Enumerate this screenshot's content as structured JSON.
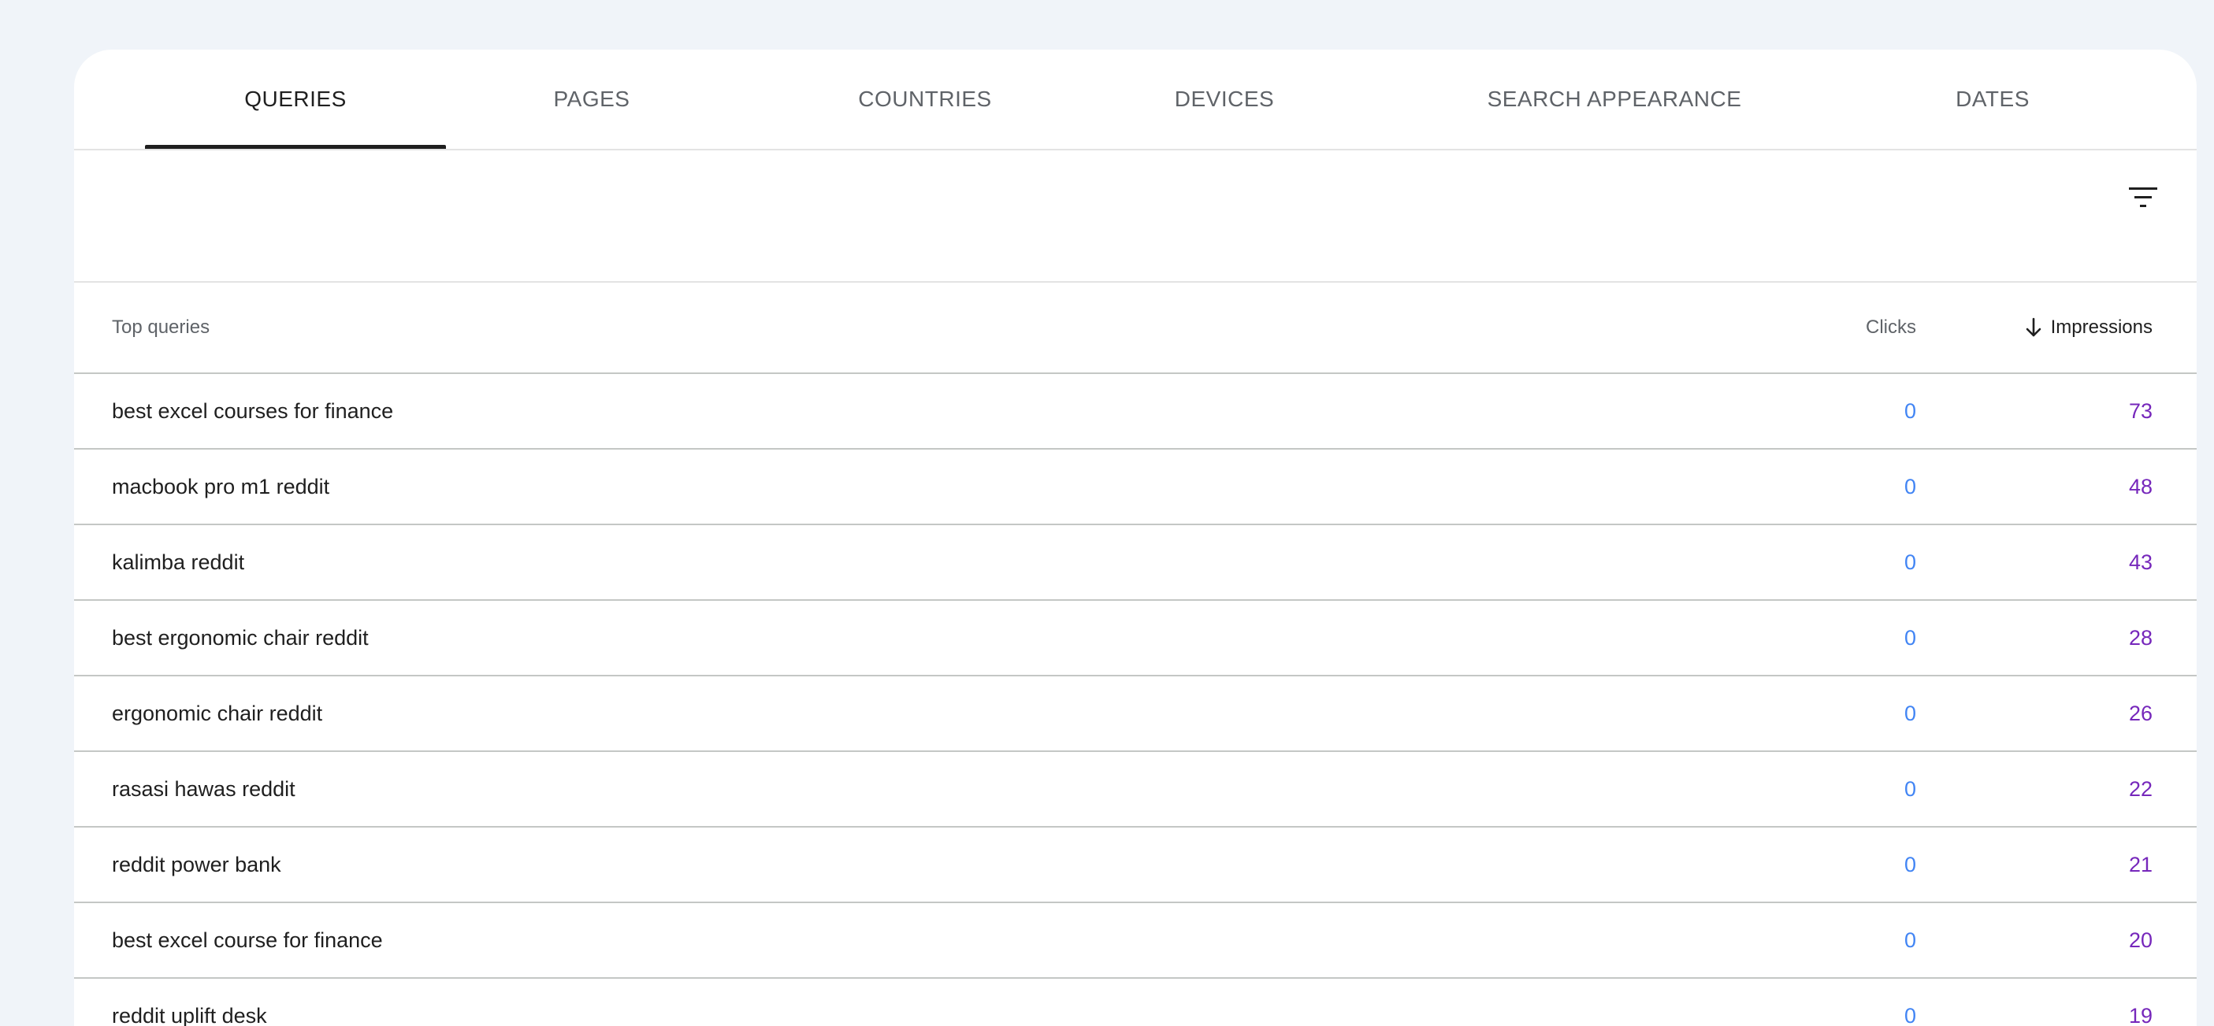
{
  "tabs": [
    {
      "label": "QUERIES",
      "active": true
    },
    {
      "label": "PAGES",
      "active": false
    },
    {
      "label": "COUNTRIES",
      "active": false
    },
    {
      "label": "DEVICES",
      "active": false
    },
    {
      "label": "SEARCH APPEARANCE",
      "active": false
    },
    {
      "label": "DATES",
      "active": false
    }
  ],
  "toolbar": {
    "filter_icon": "filter-list-icon"
  },
  "table": {
    "headers": {
      "query": "Top queries",
      "clicks": "Clicks",
      "impressions": "Impressions",
      "sort_icon": "arrow-down-icon"
    },
    "rows": [
      {
        "query": "best excel courses for finance",
        "clicks": "0",
        "impressions": "73"
      },
      {
        "query": "macbook pro m1 reddit",
        "clicks": "0",
        "impressions": "48"
      },
      {
        "query": "kalimba reddit",
        "clicks": "0",
        "impressions": "43"
      },
      {
        "query": "best ergonomic chair reddit",
        "clicks": "0",
        "impressions": "28"
      },
      {
        "query": "ergonomic chair reddit",
        "clicks": "0",
        "impressions": "26"
      },
      {
        "query": "rasasi hawas reddit",
        "clicks": "0",
        "impressions": "22"
      },
      {
        "query": "reddit power bank",
        "clicks": "0",
        "impressions": "21"
      },
      {
        "query": "best excel course for finance",
        "clicks": "0",
        "impressions": "20"
      },
      {
        "query": "reddit uplift desk",
        "clicks": "0",
        "impressions": "19"
      }
    ]
  },
  "colors": {
    "background": "#f0f4f9",
    "clicks": "#4285f4",
    "impressions": "#7627bb",
    "active_tab": "#1f1f1f",
    "inactive_tab": "#5f6368"
  }
}
